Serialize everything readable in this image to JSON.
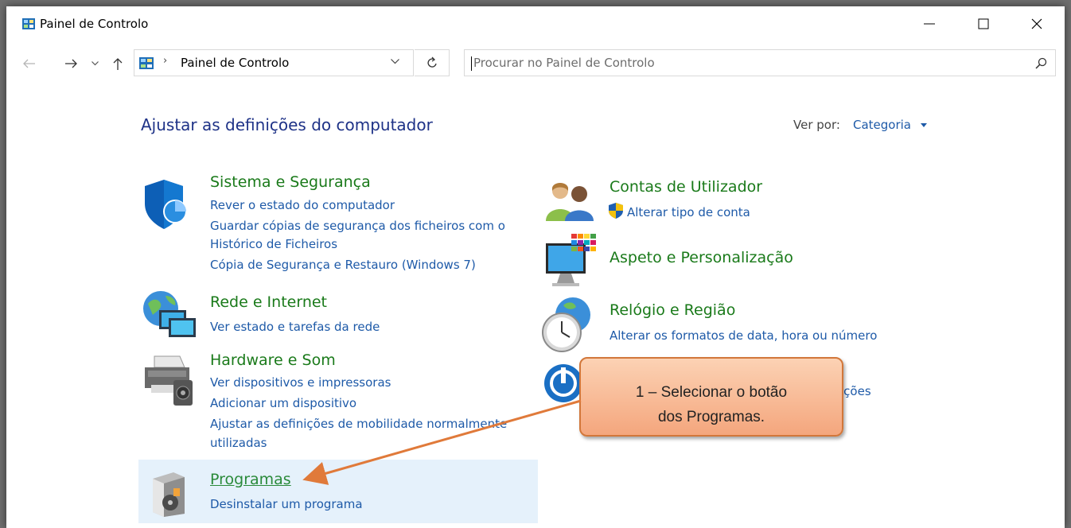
{
  "window": {
    "title": "Painel de Controlo"
  },
  "address": {
    "crumb": "Painel de Controlo"
  },
  "search": {
    "placeholder": "Procurar no Painel de Controlo"
  },
  "main": {
    "heading": "Ajustar as definições do computador",
    "view_by_label": "Ver por:",
    "view_by_value": "Categoria"
  },
  "categories": {
    "system": {
      "title": "Sistema e Segurança",
      "icon": "shield-icon",
      "links": [
        "Rever o estado do computador",
        "Guardar cópias de segurança dos ficheiros com o",
        "Histórico de Ficheiros",
        "Cópia de Segurança e Restauro (Windows 7)"
      ]
    },
    "network": {
      "title": "Rede e Internet",
      "icon": "network-globe-icon",
      "links": [
        "Ver estado e tarefas da rede"
      ]
    },
    "hardware": {
      "title": "Hardware e Som",
      "icon": "printer-icon",
      "links": [
        "Ver dispositivos e impressoras",
        "Adicionar um dispositivo",
        "Ajustar as definições de mobilidade normalmente",
        "utilizadas"
      ]
    },
    "programs": {
      "title": "Programas",
      "icon": "programs-icon",
      "links": [
        "Desinstalar um programa"
      ]
    },
    "accounts": {
      "title": "Contas de Utilizador",
      "icon": "users-icon",
      "links": [
        "Alterar tipo de conta"
      ]
    },
    "appearance": {
      "title": "Aspeto e Personalização",
      "icon": "monitor-palette-icon",
      "links": []
    },
    "clock": {
      "title": "Relógio e Região",
      "icon": "clock-globe-icon",
      "links": [
        "Alterar os formatos de data, hora ou número"
      ]
    },
    "ease": {
      "title": "",
      "icon": "ease-of-access-icon",
      "links": [
        "ições"
      ]
    }
  },
  "callout": {
    "line1": "1 – Selecionar o botão",
    "line2": "dos Programas."
  },
  "colors": {
    "heading": "#1e3287",
    "category_title": "#1a7a1a",
    "link": "#1e5aa8",
    "highlight": "#e5f1fb",
    "callout_fill": "#f4a67d",
    "callout_border": "#d2773a",
    "arrow": "#e07a3a"
  }
}
